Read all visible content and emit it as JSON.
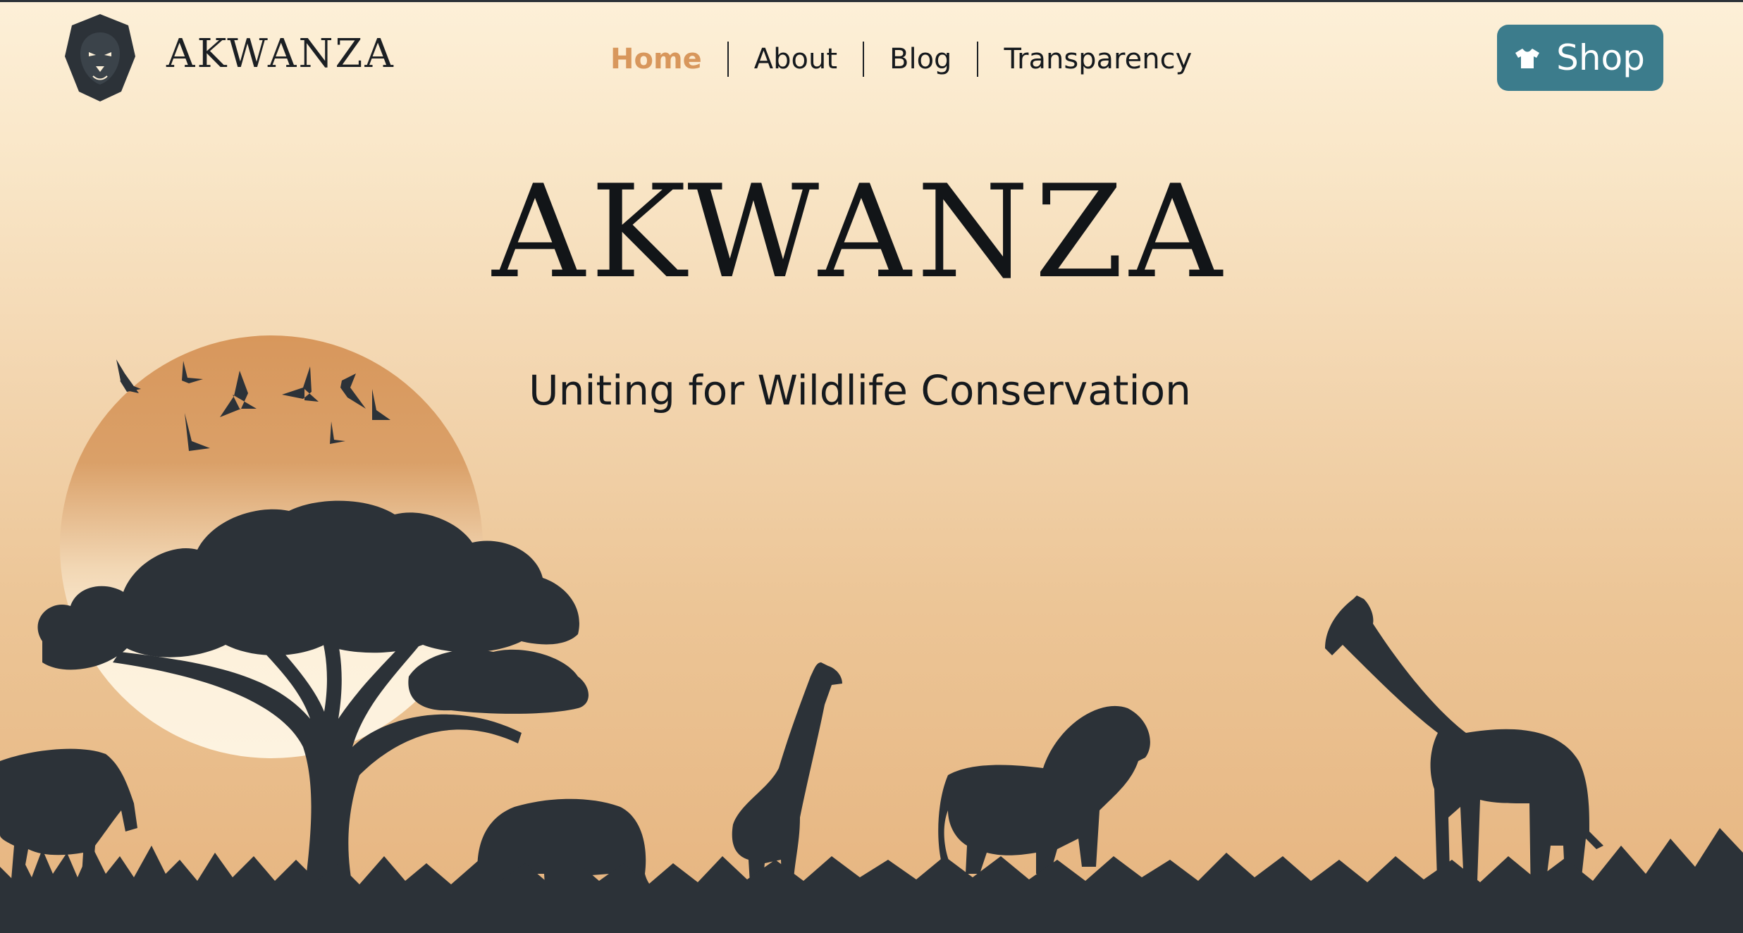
{
  "brand": {
    "name": "AKWANZA"
  },
  "nav": {
    "items": [
      {
        "label": "Home",
        "active": true
      },
      {
        "label": "About",
        "active": false
      },
      {
        "label": "Blog",
        "active": false
      },
      {
        "label": "Transparency",
        "active": false
      }
    ]
  },
  "shop_button": {
    "label": "Shop",
    "icon": "tshirt-icon"
  },
  "hero": {
    "title": "AKWANZA",
    "subtitle": "Uniting for Wildlife Conservation"
  },
  "colors": {
    "accent": "#d8975c",
    "button": "#3c7c8c",
    "silhouette": "#2c3238",
    "sun_top": "#d8975c",
    "sun_bottom": "#fdf1dc"
  }
}
